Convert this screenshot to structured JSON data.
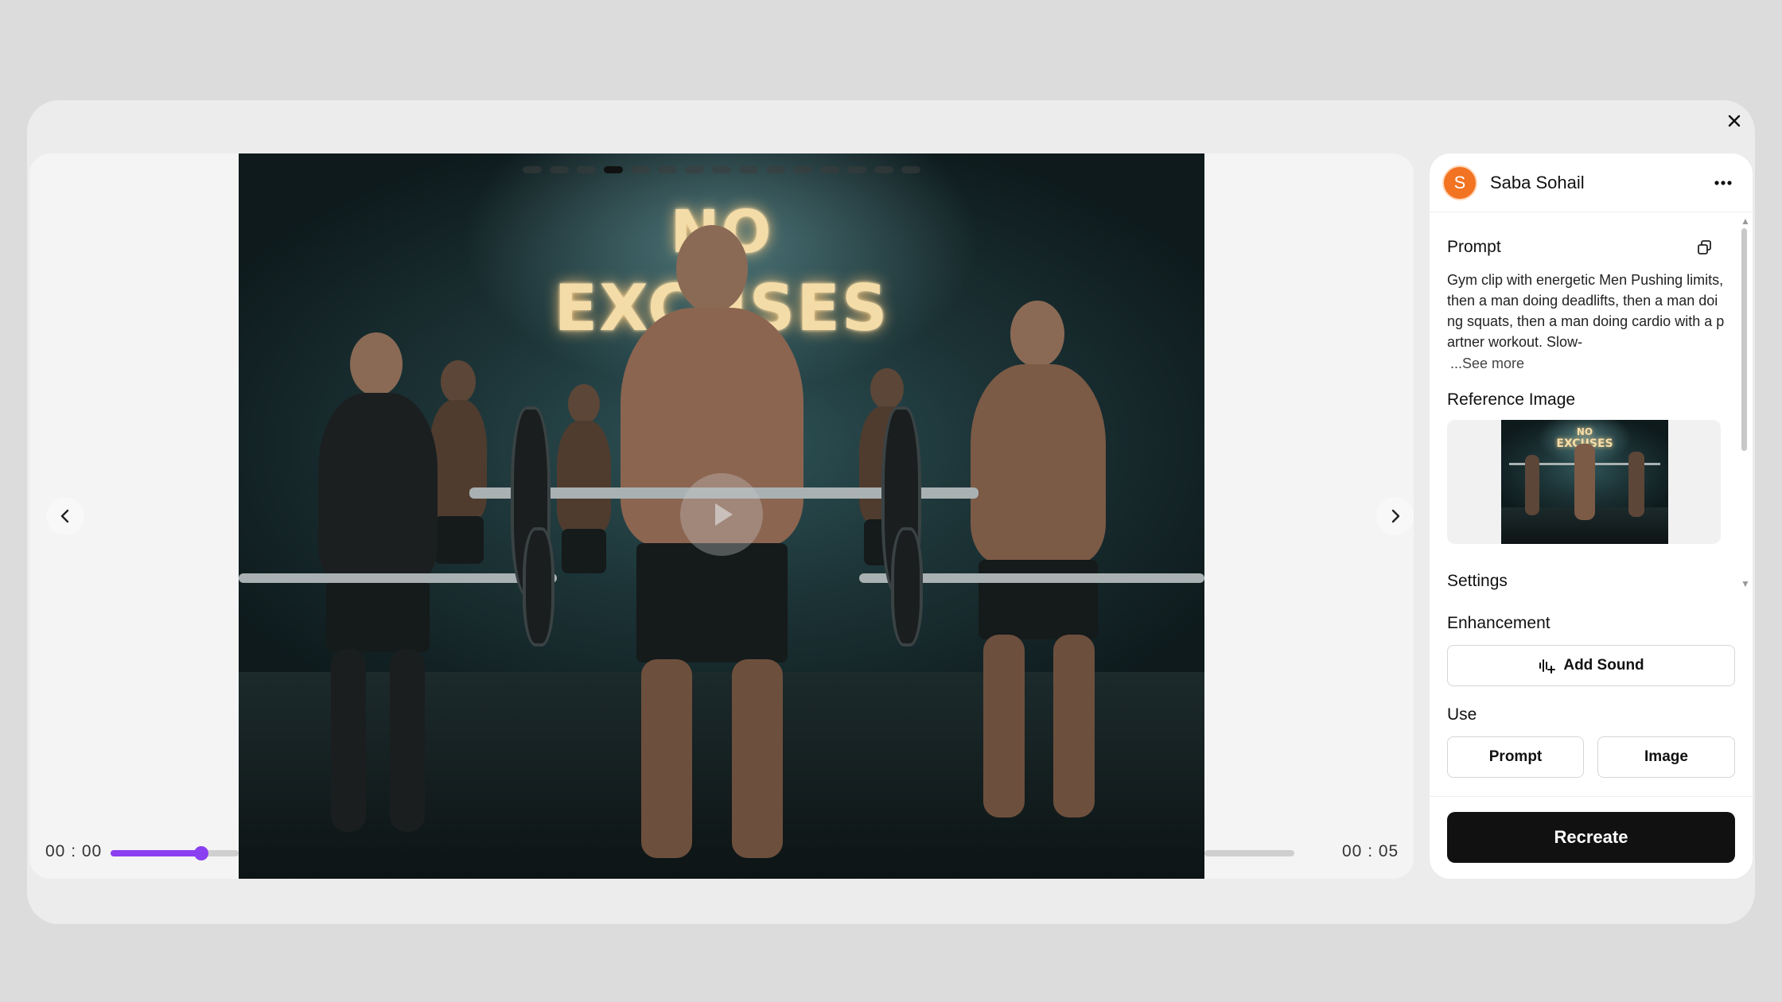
{
  "player": {
    "time_current": "00 : 00",
    "time_total": "00 : 05",
    "progress_fraction": 0.0,
    "active_slide": 4,
    "slide_count": 15,
    "neon_line1": "NO",
    "neon_line2": "EXCUSES"
  },
  "panel": {
    "user": {
      "initial": "S",
      "name": "Saba Sohail"
    },
    "prompt_title": "Prompt",
    "prompt_text": "Gym clip with energetic Men Pushing limits, then a man doing deadlifts, then a man doing squats, then a man doing cardio with a partner workout. Slow-",
    "see_more": "...See more",
    "reference_title": "Reference Image",
    "settings_title": "Settings",
    "enhancement_title": "Enhancement",
    "add_sound_label": "Add Sound",
    "use_title": "Use",
    "use_prompt_label": "Prompt",
    "use_image_label": "Image",
    "recreate_label": "Recreate"
  },
  "colors": {
    "accent": "#8a3ff0",
    "avatar": "#f27321",
    "primary_button": "#111111"
  }
}
